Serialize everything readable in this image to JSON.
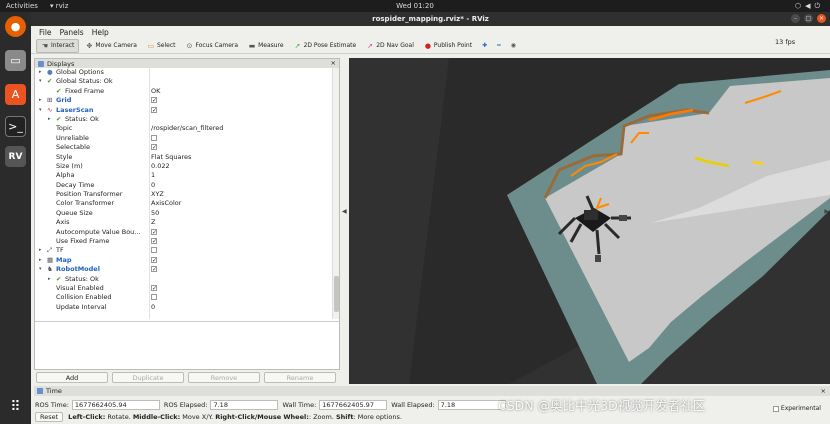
{
  "topbar": {
    "activities": "Activities",
    "app_name": "rviz",
    "clock": "Wed 01:20"
  },
  "window": {
    "title": "rospider_mapping.rviz* - RViz"
  },
  "menu": [
    "File",
    "Panels",
    "Help"
  ],
  "toolbar": [
    {
      "label": "Interact",
      "icon": "hand-icon",
      "active": true
    },
    {
      "label": "Move Camera",
      "icon": "move-camera-icon"
    },
    {
      "label": "Select",
      "icon": "select-icon"
    },
    {
      "label": "Focus Camera",
      "icon": "focus-icon"
    },
    {
      "label": "Measure",
      "icon": "ruler-icon"
    },
    {
      "label": "2D Pose Estimate",
      "icon": "green-arrow-icon"
    },
    {
      "label": "2D Nav Goal",
      "icon": "pink-arrow-icon"
    },
    {
      "label": "Publish Point",
      "icon": "pin-icon"
    }
  ],
  "displays": {
    "title": "Displays",
    "rows": [
      {
        "label": "Global Options",
        "indent": 0,
        "arrow": "▸",
        "icon": "gear-icon"
      },
      {
        "label": "Global Status: Ok",
        "indent": 0,
        "arrow": "▾",
        "icon": "check-icon"
      },
      {
        "label": "Fixed Frame",
        "indent": 1,
        "icon": "check-icon",
        "value": "OK"
      },
      {
        "label": "Grid",
        "indent": 0,
        "arrow": "▸",
        "icon": "grid-icon",
        "blue": true,
        "checkbox": true
      },
      {
        "label": "LaserScan",
        "indent": 0,
        "arrow": "▾",
        "icon": "laser-icon",
        "blue": true,
        "checkbox": true
      },
      {
        "label": "Status: Ok",
        "indent": 1,
        "arrow": "▸",
        "icon": "check-icon"
      },
      {
        "label": "Topic",
        "indent": 1,
        "value": "/rospider/scan_filtered"
      },
      {
        "label": "Unreliable",
        "indent": 1,
        "checkbox": false
      },
      {
        "label": "Selectable",
        "indent": 1,
        "checkbox": true
      },
      {
        "label": "Style",
        "indent": 1,
        "value": "Flat Squares"
      },
      {
        "label": "Size (m)",
        "indent": 1,
        "value": "0.022"
      },
      {
        "label": "Alpha",
        "indent": 1,
        "value": "1"
      },
      {
        "label": "Decay Time",
        "indent": 1,
        "value": "0"
      },
      {
        "label": "Position Transformer",
        "indent": 1,
        "value": "XYZ"
      },
      {
        "label": "Color Transformer",
        "indent": 1,
        "value": "AxisColor"
      },
      {
        "label": "Queue Size",
        "indent": 1,
        "value": "50"
      },
      {
        "label": "Axis",
        "indent": 1,
        "value": "Z"
      },
      {
        "label": "Autocompute Value Bou...",
        "indent": 1,
        "checkbox": true
      },
      {
        "label": "Use Fixed Frame",
        "indent": 1,
        "checkbox": true
      },
      {
        "label": "TF",
        "indent": 0,
        "arrow": "▸",
        "icon": "tf-icon",
        "checkbox": false
      },
      {
        "label": "Map",
        "indent": 0,
        "arrow": "▸",
        "icon": "map-icon",
        "blue": true,
        "checkbox": true
      },
      {
        "label": "RobotModel",
        "indent": 0,
        "arrow": "▾",
        "icon": "robot-icon",
        "blue": true,
        "checkbox": true
      },
      {
        "label": "Status: Ok",
        "indent": 1,
        "arrow": "▸",
        "icon": "check-icon"
      },
      {
        "label": "Visual Enabled",
        "indent": 1,
        "checkbox": true
      },
      {
        "label": "Collision Enabled",
        "indent": 1,
        "checkbox": false
      },
      {
        "label": "Update Interval",
        "indent": 1,
        "value": "0"
      }
    ],
    "buttons": [
      {
        "label": "Add",
        "enabled": true
      },
      {
        "label": "Duplicate",
        "enabled": false
      },
      {
        "label": "Remove",
        "enabled": false
      },
      {
        "label": "Rename",
        "enabled": false
      }
    ]
  },
  "time": {
    "title": "Time",
    "ros_time_label": "ROS Time:",
    "ros_time": "1677662405.94",
    "ros_elapsed_label": "ROS Elapsed:",
    "ros_elapsed": "7.18",
    "wall_time_label": "Wall Time:",
    "wall_time": "1677662405.97",
    "wall_elapsed_label": "Wall Elapsed:",
    "wall_elapsed": "7.18",
    "experimental": "Experimental"
  },
  "status": {
    "reset": "Reset",
    "hint_parts": [
      {
        "text": "Left-Click:",
        "bold": true
      },
      {
        "text": " Rotate. ",
        "bold": false
      },
      {
        "text": "Middle-Click:",
        "bold": true
      },
      {
        "text": " Move X/Y. ",
        "bold": false
      },
      {
        "text": "Right-Click/Mouse Wheel:",
        "bold": true
      },
      {
        "text": ": Zoom. ",
        "bold": false
      },
      {
        "text": "Shift",
        "bold": true
      },
      {
        "text": ": More options.",
        "bold": false
      }
    ],
    "fps": "13 fps"
  },
  "watermark": "CSDN @奥比中光3D视觉开发者社区",
  "colors": {
    "accent": "#e95420",
    "map_free": "#c8c8c8",
    "map_unknown": "#6d8d8d",
    "scan": "#ff8a00",
    "view_bg": "#313131"
  }
}
